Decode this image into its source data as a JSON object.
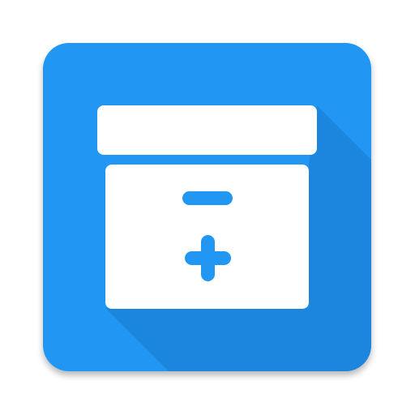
{
  "icon": {
    "name": "archive-box-plus-minus-icon",
    "colors": {
      "tile": "#2196F3",
      "tile_shadow": "#1C86DF",
      "glyph": "#FFFFFF"
    }
  }
}
